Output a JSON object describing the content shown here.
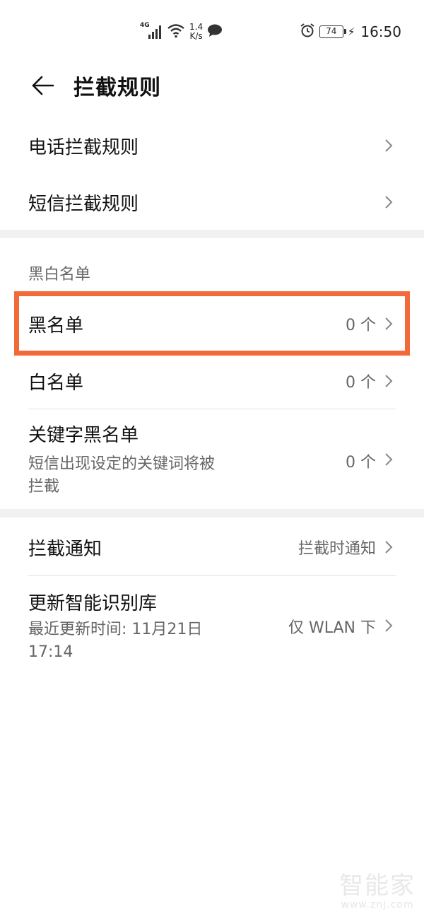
{
  "status_bar": {
    "network": "4G",
    "speed_value": "1.4",
    "speed_unit": "K/s",
    "battery": "74",
    "time": "16:50",
    "icons": [
      "signal-icon",
      "wifi-icon",
      "message-icon",
      "alarm-icon",
      "battery-icon",
      "charging-icon"
    ]
  },
  "header": {
    "title": "拦截规则"
  },
  "rules": [
    {
      "label": "电话拦截规则"
    },
    {
      "label": "短信拦截规则"
    }
  ],
  "lists_section": {
    "label": "黑白名单",
    "items": [
      {
        "label": "黑名单",
        "value": "0 个"
      },
      {
        "label": "白名单",
        "value": "0 个"
      },
      {
        "label": "关键字黑名单",
        "subtitle_line1": "短信出现设定的关键词将被",
        "subtitle_line2": "拦截",
        "value": "0 个"
      }
    ]
  },
  "other": {
    "notify": {
      "label": "拦截通知",
      "value": "拦截时通知"
    },
    "update": {
      "label": "更新智能识别库",
      "subtitle_line1": "最近更新时间: 11月21日",
      "subtitle_line2": "17:14",
      "value": "仅 WLAN 下"
    }
  },
  "watermark": {
    "brand": "智能家",
    "url": "www.znj.com"
  },
  "colors": {
    "highlight": "#f26a3a",
    "section_gap": "#f1f1f1"
  }
}
